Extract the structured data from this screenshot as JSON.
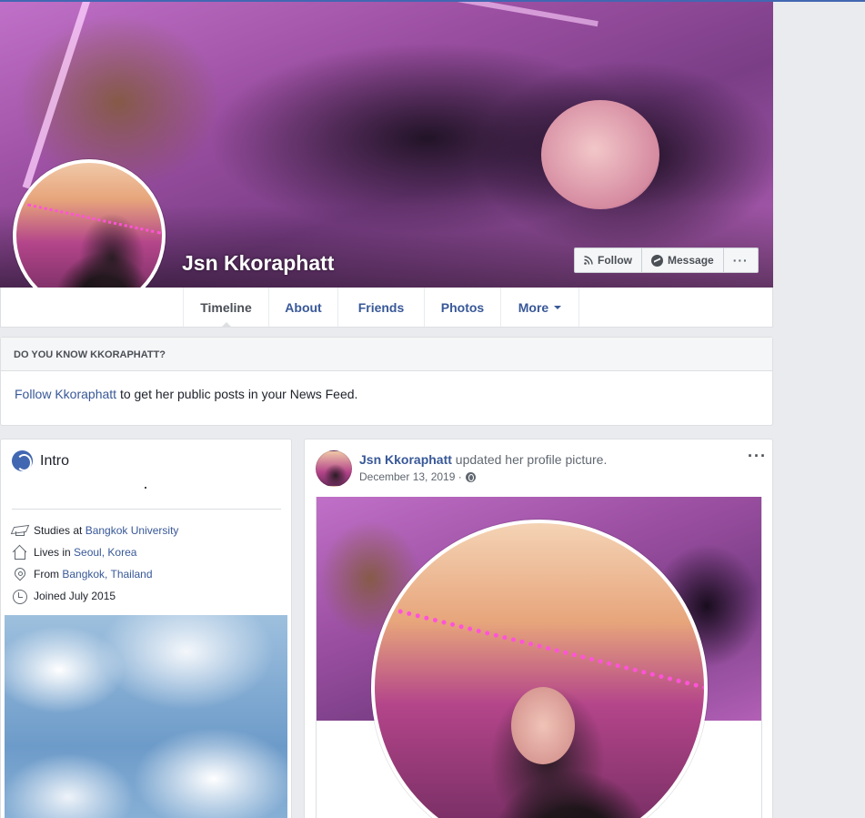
{
  "profile": {
    "name": "Jsn Kkoraphatt"
  },
  "cover_actions": {
    "follow": "Follow",
    "message": "Message",
    "more": "···"
  },
  "tabs": [
    {
      "label": "Timeline",
      "active": true
    },
    {
      "label": "About"
    },
    {
      "label": "Friends"
    },
    {
      "label": "Photos"
    },
    {
      "label": "More"
    }
  ],
  "know_box": {
    "header": "DO YOU KNOW KKORAPHATT?",
    "follow_link": "Follow Kkoraphatt",
    "text": " to get her public posts in your News Feed."
  },
  "intro": {
    "title": "Intro",
    "studies_prefix": "Studies at ",
    "studies_link": "Bangkok University",
    "lives_prefix": "Lives in ",
    "lives_link": "Seoul, Korea",
    "from_prefix": "From ",
    "from_link": "Bangkok, Thailand",
    "joined": "Joined July 2015"
  },
  "post": {
    "author": "Jsn Kkoraphatt",
    "action": " updated her profile picture.",
    "date": "December 13, 2019 ·",
    "more": "···"
  },
  "colors": {
    "link": "#385898",
    "brand": "#4267b2",
    "page_bg": "#e9ebee"
  }
}
